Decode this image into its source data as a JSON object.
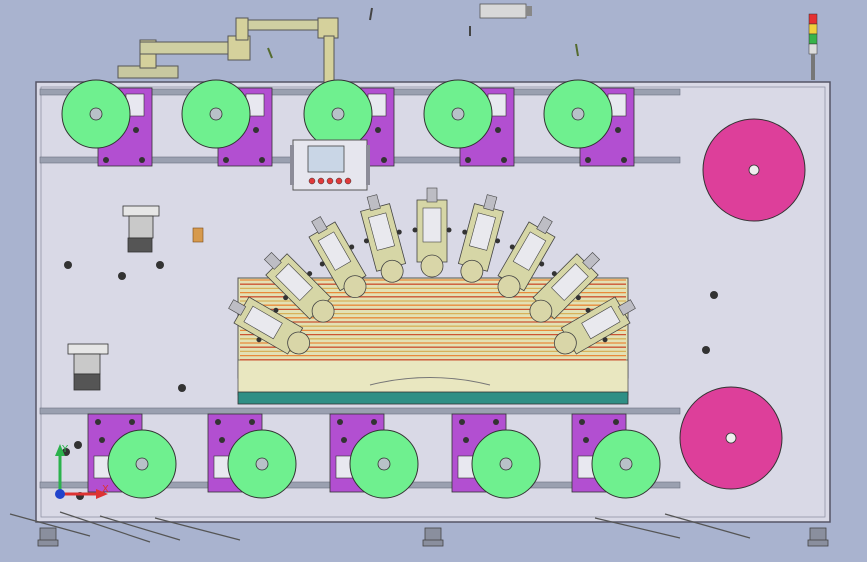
{
  "viewport": {
    "background": "#a9b3cf",
    "axis_triad": {
      "x_label": "X",
      "y_label": "Y"
    }
  },
  "machine": {
    "frame_color": "#d9d9e6",
    "frame_edge": "#555566",
    "roll_color": "#6ff08f",
    "roll_hub": "#b8c2c8",
    "bracket_color": "#b24fd1",
    "big_reel_color": "#dd3f9a",
    "rail_color": "#9aa0b0",
    "mandrel_color": "#d6d6a6",
    "strip_colors": [
      "#e98a3a",
      "#cc5533",
      "#d7b25a"
    ],
    "bed_color": "#e3e1b4",
    "bed_base_color": "#2f8f85"
  },
  "parts": {
    "top_unwind_rolls": 5,
    "bottom_rewind_rolls": 5,
    "large_reels": 2,
    "radial_heads": 9,
    "control_panel": {
      "name": "hmi-panel",
      "screen_color": "#c9d6e6",
      "button_colors": [
        "#e23a3a",
        "#e23a3a",
        "#e23a3a",
        "#e23a3a",
        "#e23a3a"
      ]
    },
    "signal_tower_colors": [
      "#e53131",
      "#f0d13c",
      "#37b34a",
      "#dddddd"
    ]
  }
}
